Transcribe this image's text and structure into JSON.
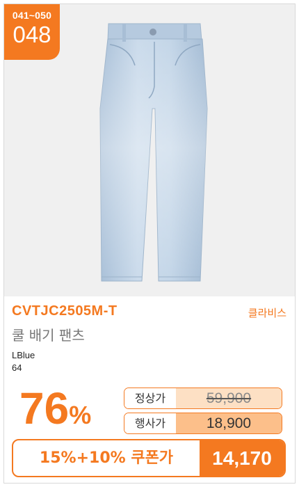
{
  "badge": {
    "range": "041~050",
    "number": "048"
  },
  "product": {
    "code": "CVTJC2505M-T",
    "brand": "클라비스",
    "name": "쿨 배기 팬츠",
    "color": "LBlue",
    "size": "64"
  },
  "pricing": {
    "discount": "76",
    "discount_unit": "%",
    "regular_label": "정상가",
    "regular_price": "59,900",
    "event_label": "행사가",
    "event_price": "18,900",
    "coupon_label": "15%+10% 쿠폰가",
    "coupon_price": "14,170"
  },
  "colors": {
    "accent": "#f47920",
    "denim": "#bcd0e4"
  },
  "icons": {
    "product_image": "light-blue-jeans"
  }
}
